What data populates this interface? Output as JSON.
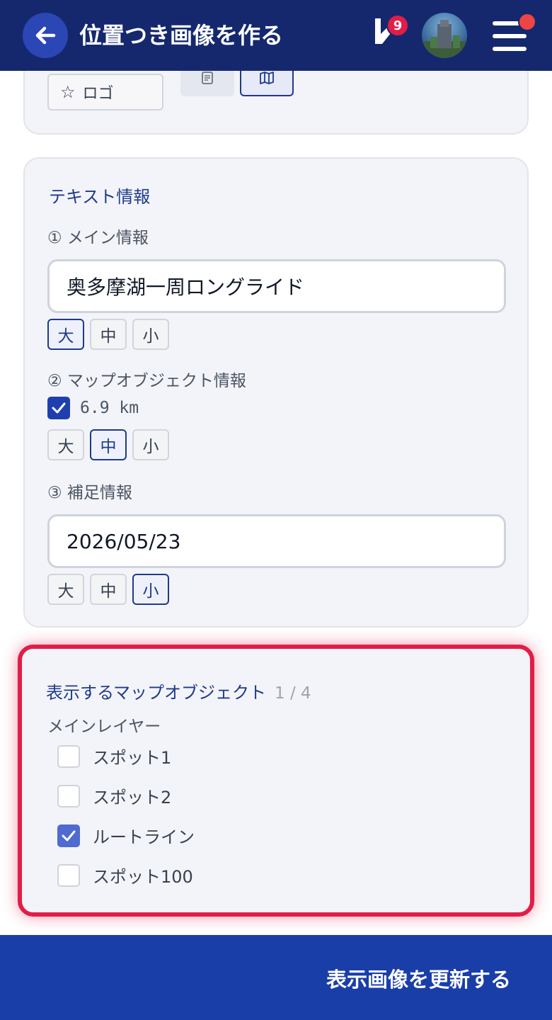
{
  "header": {
    "title": "位置つき画像を作る",
    "notification_count": "9",
    "colors": {
      "background": "#15286e",
      "back_button": "#2b46b5",
      "badge": "#e11d48"
    }
  },
  "top_card": {
    "logo_button": {
      "icon": "star-icon",
      "label": "ロゴ"
    },
    "tool_buttons": [
      {
        "icon": "document-icon",
        "selected": false
      },
      {
        "icon": "map-icon",
        "selected": true
      }
    ]
  },
  "text_info": {
    "title": "テキスト情報",
    "main": {
      "label": "① メイン情報",
      "value": "奥多摩湖一周ロングライド",
      "sizes": [
        "大",
        "中",
        "小"
      ],
      "selected_size": "大"
    },
    "map_object": {
      "label": "② マップオブジェクト情報",
      "checked": true,
      "value": "6.9 km",
      "sizes": [
        "大",
        "中",
        "小"
      ],
      "selected_size": "中"
    },
    "supplement": {
      "label": "③ 補足情報",
      "value": "2026/05/23",
      "sizes": [
        "大",
        "中",
        "小"
      ],
      "selected_size": "小"
    }
  },
  "map_objects": {
    "title": "表示するマップオブジェクト",
    "count": "1 / 4",
    "layer_label": "メインレイヤー",
    "items": [
      {
        "label": "スポット1",
        "checked": false
      },
      {
        "label": "スポット2",
        "checked": false
      },
      {
        "label": "ルートライン",
        "checked": true
      },
      {
        "label": "スポット100",
        "checked": false
      }
    ],
    "highlight_color": "#e11d48"
  },
  "footer": {
    "update_button": "表示画像を更新する",
    "color": "#1a3ea8"
  }
}
